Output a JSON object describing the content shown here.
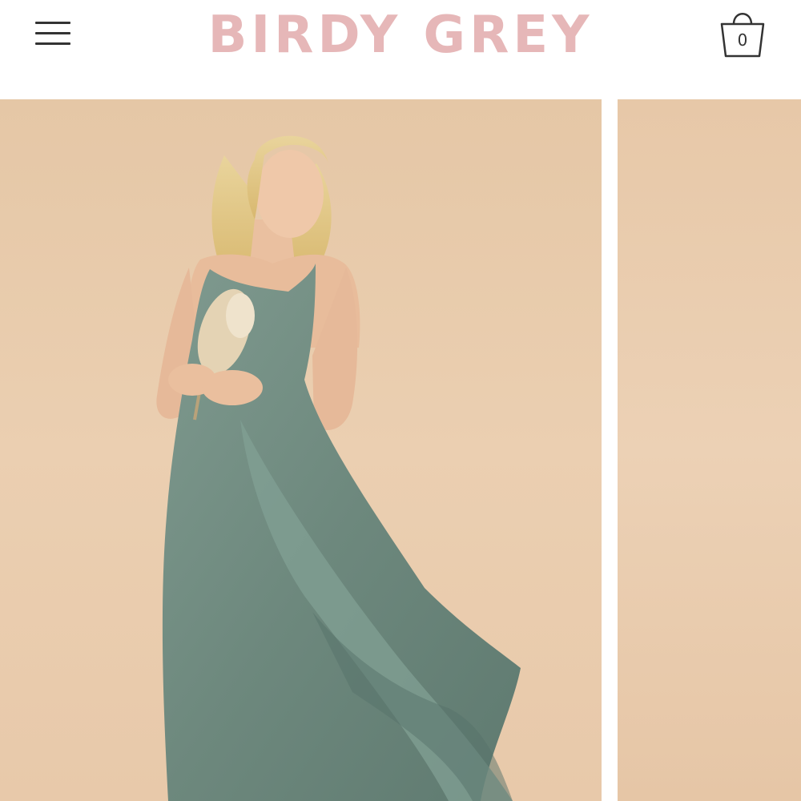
{
  "header": {
    "menu_icon": "hamburger-menu-icon",
    "logo_text": "BIRDY GREY",
    "cart_icon": "shopping-bag-icon",
    "cart_count": "0"
  },
  "colors": {
    "brand_pink": "#e6b7b8",
    "icon_dark": "#333333",
    "backdrop_beige": "#e8caa9",
    "dress_sage": "#6f8b80"
  },
  "gallery": {
    "slides": [
      {
        "image": "model-in-sage-dress-with-dried-bouquet"
      },
      {
        "image": "product-photo-next"
      }
    ]
  }
}
